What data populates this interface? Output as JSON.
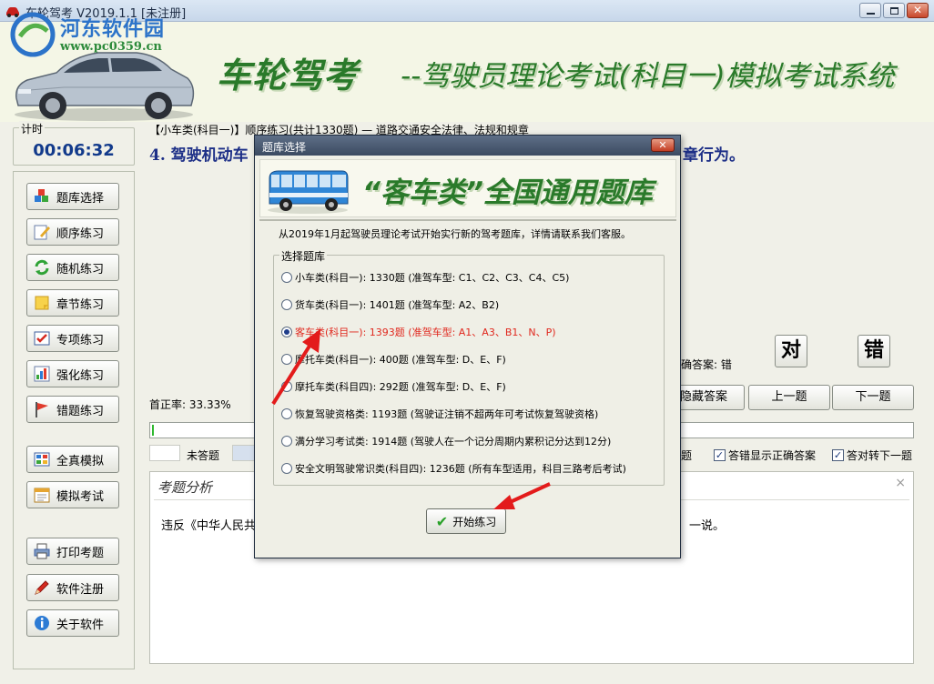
{
  "window": {
    "title": "车轮驾考 V2019.1.1 [未注册]",
    "controls": {
      "minimize": "—",
      "maximize": "□",
      "close": "✕"
    }
  },
  "header": {
    "banner": "车轮驾考",
    "subtitle": "--驾驶员理论考试(科目一)模拟考试系统",
    "watermark_name": "河东软件园",
    "watermark_url": "www.pc0359.cn"
  },
  "timer": {
    "label": "计时",
    "value": "00:06:32"
  },
  "sidebar": {
    "items": [
      {
        "label": "题库选择",
        "icon": "cubes-icon"
      },
      {
        "label": "顺序练习",
        "icon": "edit-icon"
      },
      {
        "label": "随机练习",
        "icon": "refresh-icon"
      },
      {
        "label": "章节练习",
        "icon": "note-icon"
      },
      {
        "label": "专项练习",
        "icon": "check-list-icon"
      },
      {
        "label": "强化练习",
        "icon": "bar-chart-icon"
      },
      {
        "label": "错题练习",
        "icon": "flag-icon"
      },
      {
        "label": "全真模拟",
        "icon": "grid-icon"
      },
      {
        "label": "模拟考试",
        "icon": "calendar-icon"
      },
      {
        "label": "打印考题",
        "icon": "printer-icon"
      },
      {
        "label": "软件注册",
        "icon": "pencil-icon"
      },
      {
        "label": "关于软件",
        "icon": "info-icon"
      }
    ]
  },
  "main": {
    "breadcrumb": "【小车类(科目一)】顺序练习(共计1330题) — 道路交通安全法律、法规和规章",
    "question_start": "4. 驾驶机动车",
    "question_end": "章行为。",
    "answer_label": "确答案: 错",
    "correct_button": "对",
    "wrong_button": "错",
    "hide_answer_button": "隐藏答案",
    "prev_button": "上一题",
    "next_button": "下一题",
    "accuracy": "首正率: 33.33%",
    "progress_fraction": 0.002,
    "legend_unanswered": "未答题",
    "legend_partial": "题",
    "options": [
      {
        "label": "答错显示正确答案",
        "checked": true
      },
      {
        "label": "答对转下一题",
        "checked": true
      }
    ],
    "analysis_title": "考题分析",
    "analysis_close": "×",
    "analysis_text_start": "违反《中华人民共",
    "analysis_text_end": "一说。"
  },
  "dialog": {
    "title": "题库选择",
    "close": "✕",
    "banner": "“客车类”全国通用题库",
    "notice": "从2019年1月起驾驶员理论考试开始实行新的驾考题库，详情请联系我们客服。",
    "group_label": "选择题库",
    "options": [
      {
        "label": "小车类(科目一): 1330题 (准驾车型: C1、C2、C3、C4、C5)",
        "selected": false
      },
      {
        "label": "货车类(科目一): 1401题 (准驾车型: A2、B2)",
        "selected": false
      },
      {
        "label": "客车类(科目一): 1393题 (准驾车型: A1、A3、B1、N、P)",
        "selected": true
      },
      {
        "label": "摩托车类(科目一): 400题 (准驾车型: D、E、F)",
        "selected": false
      },
      {
        "label": "摩托车类(科目四): 292题 (准驾车型: D、E、F)",
        "selected": false
      },
      {
        "label": "恢复驾驶资格类: 1193题 (驾驶证注销不超两年可考试恢复驾驶资格)",
        "selected": false
      },
      {
        "label": "满分学习考试类: 1914题 (驾驶人在一个记分周期内累积记分达到12分)",
        "selected": false
      },
      {
        "label": "安全文明驾驶常识类(科目四): 1236题 (所有车型适用，科目三路考后考试)",
        "selected": false
      }
    ],
    "start_button": "开始练习"
  },
  "colors": {
    "banner_green": "#2a7a2a",
    "question_blue": "#1d2f87",
    "selected_red": "#e0281e",
    "annotation_red": "#e31b1b"
  }
}
